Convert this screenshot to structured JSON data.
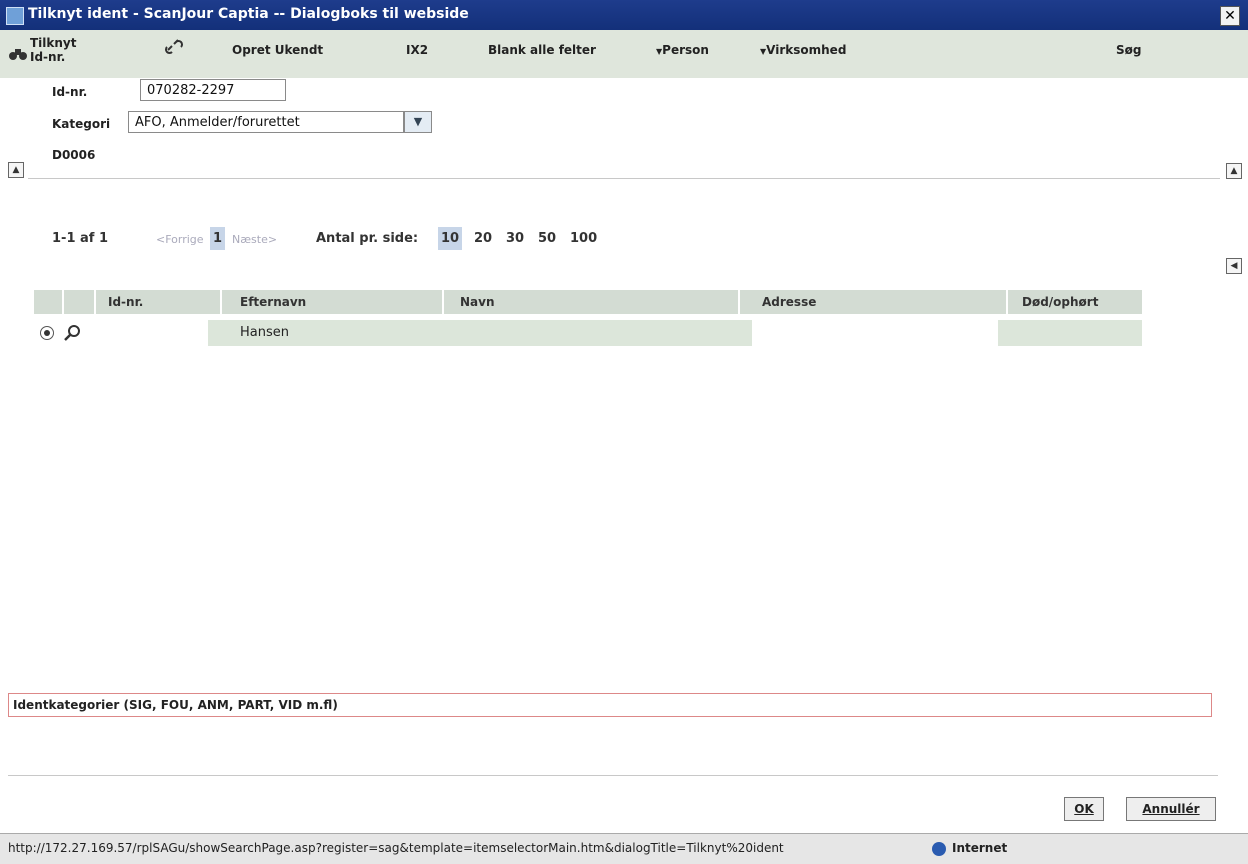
{
  "window": {
    "title": "Tilknyt ident - ScanJour Captia -- Dialogboks til webside",
    "close_glyph": "✕"
  },
  "toolbar": {
    "tilknyt_label": "Tilknyt Id-nr.",
    "opret_label": "Opret Ukendt",
    "ix2_label": "IX2",
    "blank_label": "Blank alle felter",
    "person_label": "Person",
    "virksomhed_label": "Virksomhed",
    "sog_label": "Søg"
  },
  "form": {
    "idnr_label": "Id-nr.",
    "idnr_value": "070282-2297",
    "kategori_label": "Kategori",
    "kategori_value": "AFO, Anmelder/forurettet",
    "code": "D0006"
  },
  "pagination": {
    "range": "1-1 af 1",
    "prev": "<Forrige",
    "page": "1",
    "next": "Næste>",
    "per_page_label": "Antal pr. side:",
    "options": [
      "10",
      "20",
      "30",
      "50",
      "100"
    ],
    "selected": "10"
  },
  "table": {
    "headers": {
      "idnr": "Id-nr.",
      "efternavn": "Efternavn",
      "navn": "Navn",
      "adresse": "Adresse",
      "dod": "Død/ophørt"
    },
    "rows": [
      {
        "idnr": "",
        "efternavn": "Hansen",
        "navn": "",
        "adresse": "",
        "dod": ""
      }
    ]
  },
  "status_field": "Identkategorier (SIG, FOU, ANM, PART, VID m.fl)",
  "buttons": {
    "ok": "OK",
    "cancel": "Annullér"
  },
  "statusbar": {
    "url": "http://172.27.169.57/rplSAGu/showSearchPage.asp?register=sag&template=itemselectorMain.htm&dialogTitle=Tilknyt%20ident",
    "zone": "Internet"
  },
  "colors": {
    "titlebar": "#1e3c8c",
    "toolbar": "#dfe6dc",
    "header": "#d3dcd3",
    "selected_page": "#c7d5e8"
  }
}
